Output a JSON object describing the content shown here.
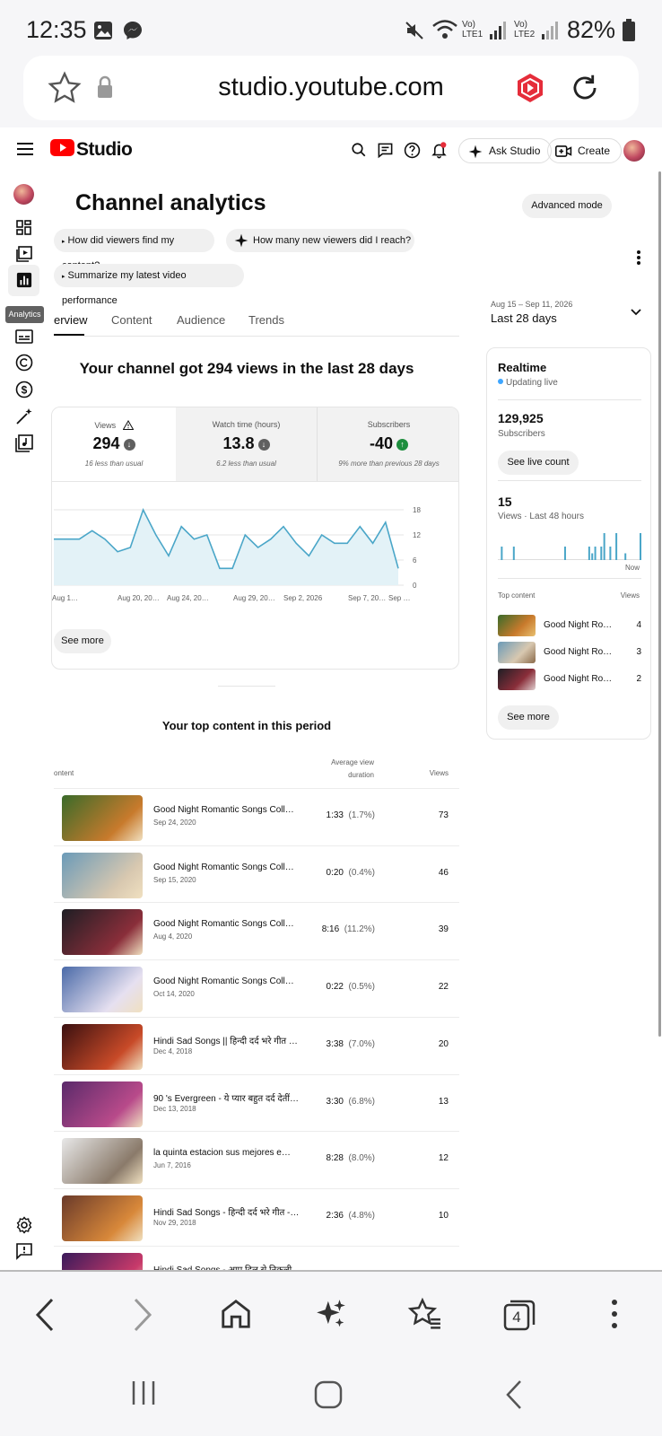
{
  "status_bar": {
    "time": "12:35",
    "signal_1": "Vo) LTE1",
    "signal_2": "Vo) LTE2",
    "battery": "82%"
  },
  "browser": {
    "url": "studio.youtube.com",
    "tab_count": "4"
  },
  "header": {
    "logo": "Studio",
    "ask_studio": "Ask Studio",
    "create": "Create"
  },
  "rail": {
    "tooltip": "Analytics"
  },
  "page": {
    "title": "Channel analytics",
    "advanced_mode": "Advanced mode"
  },
  "chips": [
    "How did viewers find my content?",
    "How many new viewers did I reach?",
    "Summarize my latest video performance"
  ],
  "tabs": [
    "erview",
    "Content",
    "Audience",
    "Trends"
  ],
  "date": {
    "range": "Aug 15 – Sep 11, 2026",
    "label": "Last 28 days"
  },
  "headline": "Your channel got 294 views in the last 28 days",
  "metrics": [
    {
      "label": "Views",
      "value": "294",
      "sub": "16 less than usual",
      "trend": "down"
    },
    {
      "label": "Watch time (hours)",
      "value": "13.8",
      "sub": "6.2 less than usual",
      "trend": "down"
    },
    {
      "label": "Subscribers",
      "value": "-40",
      "sub": "9% more than previous 28 days",
      "trend": "up"
    }
  ],
  "chart_data": {
    "type": "area",
    "x_ticks": [
      "Aug 1…",
      "Aug 20, 20…",
      "Aug 24, 20…",
      "Aug 29, 20…",
      "Sep 2, 2026",
      "Sep 7, 20…",
      "Sep …"
    ],
    "y_ticks": [
      "18",
      "12",
      "6",
      "0"
    ],
    "ylim": [
      0,
      18
    ],
    "values": [
      11,
      11,
      11,
      13,
      11,
      8,
      9,
      18,
      12,
      7,
      14,
      11,
      12,
      4,
      4,
      12,
      9,
      11,
      14,
      10,
      7,
      12,
      10,
      10,
      14,
      10,
      15,
      4
    ],
    "grid": true,
    "color": "#4aa6c8"
  },
  "see_more": "See more",
  "realtime": {
    "title": "Realtime",
    "status": "Updating live",
    "subscribers": "129,925",
    "subscribers_label": "Subscribers",
    "live_count": "See live count",
    "views": "15",
    "views_label": "Views · Last 48 hours",
    "now_label": "Now",
    "hourly_views": [
      0,
      2,
      0,
      0,
      0,
      2,
      0,
      0,
      0,
      0,
      0,
      0,
      0,
      0,
      0,
      0,
      0,
      0,
      0,
      0,
      0,
      0,
      2,
      0,
      0,
      0,
      0,
      0,
      0,
      0,
      2,
      1,
      2,
      0,
      2,
      4,
      0,
      2,
      0,
      4,
      0,
      0,
      1,
      0,
      0,
      0,
      0,
      4
    ],
    "top_content_label": "Top content",
    "views_col": "Views",
    "items": [
      {
        "name": "Good Night Ro…",
        "views": "4"
      },
      {
        "name": "Good Night Ro…",
        "views": "3"
      },
      {
        "name": "Good Night Ro…",
        "views": "2"
      }
    ],
    "see_more": "See more"
  },
  "top_content": {
    "title": "Your top content in this period",
    "col_content": "ontent",
    "col_avd_1": "Average view",
    "col_avd_2": "duration",
    "col_views": "Views",
    "rows": [
      {
        "name": "Good Night Romantic Songs Coll…",
        "date": "Sep 24, 2020",
        "duration": "1:33",
        "pct": "(1.7%)",
        "views": "73",
        "c1": "#3a6b2a",
        "c2": "#c87a2c"
      },
      {
        "name": "Good Night Romantic Songs Coll…",
        "date": "Sep 15, 2020",
        "duration": "0:20",
        "pct": "(0.4%)",
        "views": "46",
        "c1": "#6a9ab8",
        "c2": "#d8c8b0"
      },
      {
        "name": "Good Night Romantic Songs Coll…",
        "date": "Aug 4, 2020",
        "duration": "8:16",
        "pct": "(11.2%)",
        "views": "39",
        "c1": "#1e1e24",
        "c2": "#8a2e3a"
      },
      {
        "name": "Good Night Romantic Songs Coll…",
        "date": "Oct 14, 2020",
        "duration": "0:22",
        "pct": "(0.5%)",
        "views": "22",
        "c1": "#4a6aa8",
        "c2": "#e6e0f0"
      },
      {
        "name": "Hindi Sad Songs || हिन्दी दर्द भरे गीत …",
        "date": "Dec 4, 2018",
        "duration": "3:38",
        "pct": "(7.0%)",
        "views": "20",
        "c1": "#3a1010",
        "c2": "#c84a28"
      },
      {
        "name": "90 's Evergreen - ये प्यार बहुत दर्द देतीं…",
        "date": "Dec 13, 2018",
        "duration": "3:30",
        "pct": "(6.8%)",
        "views": "13",
        "c1": "#5a2a6a",
        "c2": "#b84a8a"
      },
      {
        "name": "la quinta estacion sus mejores e…",
        "date": "Jun 7, 2016",
        "duration": "8:28",
        "pct": "(8.0%)",
        "views": "12",
        "c1": "#e8e8e8",
        "c2": "#8a7a6a"
      },
      {
        "name": "Hindi Sad Songs - हिन्दी दर्द भरे गीत -…",
        "date": "Nov 29, 2018",
        "duration": "2:36",
        "pct": "(4.8%)",
        "views": "10",
        "c1": "#6a3a2a",
        "c2": "#d8883a"
      },
      {
        "name": "Hindi Sad Songs - आप दिल से निकली…",
        "date": "",
        "duration": "",
        "pct": "",
        "views": "",
        "c1": "#3a1a5a",
        "c2": "#c83a6a"
      }
    ]
  }
}
